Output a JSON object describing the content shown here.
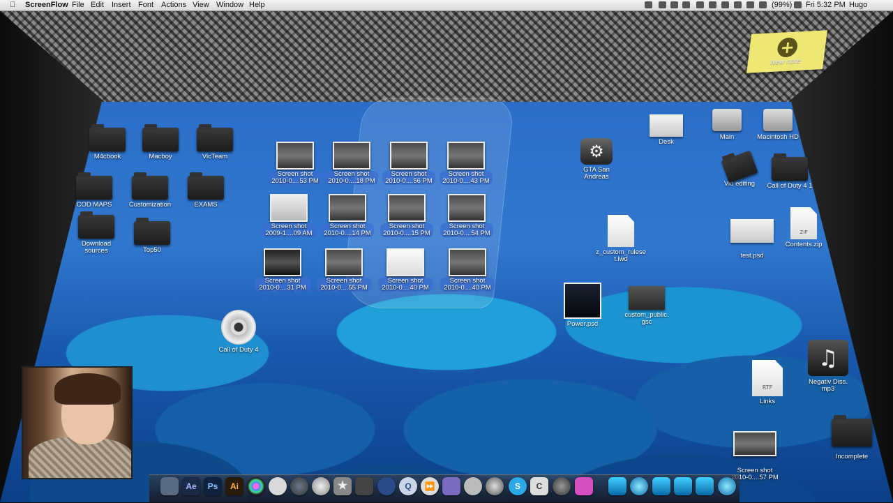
{
  "menubar": {
    "app": "ScreenFlow",
    "items": [
      "File",
      "Edit",
      "Insert",
      "Font",
      "Actions",
      "View",
      "Window",
      "Help"
    ],
    "battery": "(99%)",
    "clock": "Fri 5:32 PM",
    "user": "Hugo"
  },
  "note": {
    "label": "New note"
  },
  "folders_left": [
    "M4cbook",
    "Macboy",
    "VicTeam",
    "COD MAPS",
    "Customization",
    "EXAMS",
    "Download\nsources",
    "Top50"
  ],
  "screenshots": [
    "Screen shot\n2010-0....53 PM",
    "Screen shot\n2010-0....18 PM",
    "Screen shot\n2010-0....56 PM",
    "Screen shot\n2010-0....43 PM",
    "Screen shot\n2009-1....09 AM",
    "Screen shot\n2010-0....14 PM",
    "Screen shot\n2010-0....15 PM",
    "Screen shot\n2010-0....54 PM",
    "Screen shot\n2010-0....31 PM",
    "Screen shot\n2010-0....55 PM",
    "Screen shot\n2010-0....40 PM",
    "Screen shot\n2010-0....40 PM"
  ],
  "desktop": {
    "cod4_disc": "Call of Duty 4",
    "gta": "GTA San\nAndreas",
    "z_custom": "z_custom_rulese\nt.iwd",
    "power": "Power.psd",
    "custom_public": "custom_public.\ngsc",
    "desk": "Desk",
    "main": "Main",
    "macintosh_hd": "Macintosh HD",
    "vid_editing": "Vid editing",
    "cod41": "Call of Duty 4 1",
    "test": "test.psd",
    "contents": "Contents.zip",
    "zip_badge": "ZIP",
    "links": "Links",
    "rtf_badge": "RTF",
    "negativ": "Negativ Diss.\nmp3",
    "incomplete": "Incomplete",
    "shot_right": "Screen shot\n2010-0....57 PM"
  },
  "dock": {
    "items": [
      "Finder",
      "Ae",
      "Ps",
      "Ai",
      "Aperture",
      "Bone",
      "Globe",
      "Gear",
      "Star",
      "Movie",
      "QuickTime",
      "Q",
      "FFW",
      "Pen",
      "Game",
      "COD",
      "S",
      "C",
      "Clock",
      "Sphere"
    ],
    "labels": {
      "ae": "Ae",
      "ps": "Ps",
      "ai": "Ai",
      "q": "Q",
      "s": "S",
      "c": "C"
    }
  }
}
